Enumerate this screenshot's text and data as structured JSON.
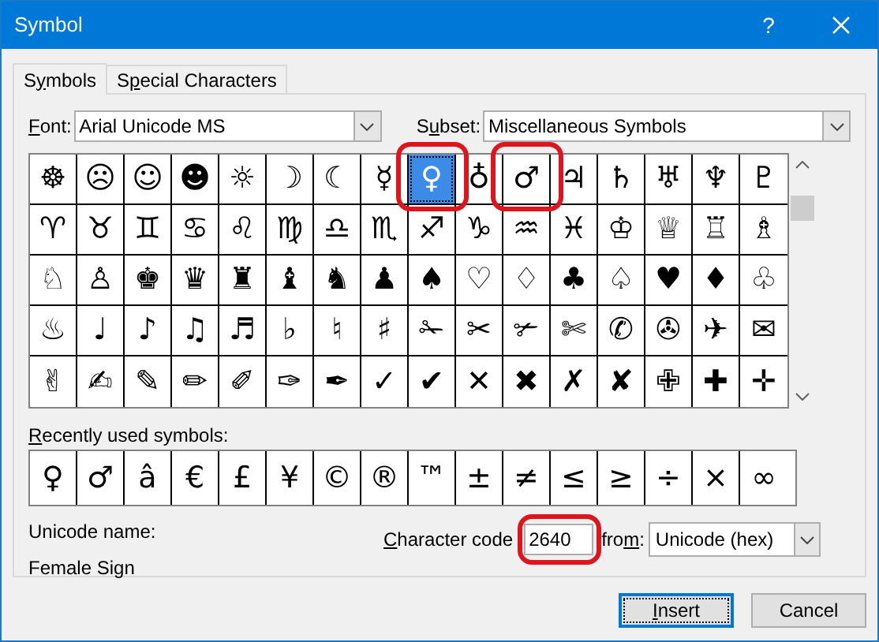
{
  "window": {
    "title": "Symbol",
    "help": "?"
  },
  "tabs": [
    {
      "label": {
        "before": "S",
        "access_key": "y",
        "after": "mbols"
      },
      "selected": true
    },
    {
      "label": {
        "before": "S",
        "access_key": "p",
        "after": "ecial Characters"
      },
      "selected": false
    }
  ],
  "font": {
    "label": {
      "access_key": "F",
      "after": "ont:"
    },
    "value": "Arial Unicode MS"
  },
  "subset": {
    "label": {
      "before": "S",
      "access_key": "u",
      "after": "bset:"
    },
    "value": "Miscellaneous Symbols"
  },
  "grid": {
    "rows": [
      [
        {
          "symbol": "☸",
          "selected": false,
          "highlighted": false
        },
        {
          "symbol": "☹",
          "selected": false,
          "highlighted": false
        },
        {
          "symbol": "☺",
          "selected": false,
          "highlighted": false
        },
        {
          "symbol": "☻",
          "selected": false,
          "highlighted": false
        },
        {
          "symbol": "☼",
          "selected": false,
          "highlighted": false
        },
        {
          "symbol": "☽",
          "selected": false,
          "highlighted": false
        },
        {
          "symbol": "☾",
          "selected": false,
          "highlighted": false
        },
        {
          "symbol": "☿",
          "selected": false,
          "highlighted": false
        },
        {
          "symbol": "♀",
          "selected": true,
          "highlighted": true
        },
        {
          "symbol": "♁",
          "selected": false,
          "highlighted": false
        },
        {
          "symbol": "♂",
          "selected": false,
          "highlighted": true
        },
        {
          "symbol": "♃",
          "selected": false,
          "highlighted": false
        },
        {
          "symbol": "♄",
          "selected": false,
          "highlighted": false
        },
        {
          "symbol": "♅",
          "selected": false,
          "highlighted": false
        },
        {
          "symbol": "♆",
          "selected": false,
          "highlighted": false
        },
        {
          "symbol": "♇",
          "selected": false,
          "highlighted": false
        }
      ],
      [
        {
          "symbol": "♈",
          "selected": false,
          "highlighted": false
        },
        {
          "symbol": "♉",
          "selected": false,
          "highlighted": false
        },
        {
          "symbol": "♊",
          "selected": false,
          "highlighted": false
        },
        {
          "symbol": "♋",
          "selected": false,
          "highlighted": false
        },
        {
          "symbol": "♌",
          "selected": false,
          "highlighted": false
        },
        {
          "symbol": "♍",
          "selected": false,
          "highlighted": false
        },
        {
          "symbol": "♎",
          "selected": false,
          "highlighted": false
        },
        {
          "symbol": "♏",
          "selected": false,
          "highlighted": false
        },
        {
          "symbol": "♐",
          "selected": false,
          "highlighted": false
        },
        {
          "symbol": "♑",
          "selected": false,
          "highlighted": false
        },
        {
          "symbol": "♒",
          "selected": false,
          "highlighted": false
        },
        {
          "symbol": "♓",
          "selected": false,
          "highlighted": false
        },
        {
          "symbol": "♔",
          "selected": false,
          "highlighted": false
        },
        {
          "symbol": "♕",
          "selected": false,
          "highlighted": false
        },
        {
          "symbol": "♖",
          "selected": false,
          "highlighted": false
        },
        {
          "symbol": "♗",
          "selected": false,
          "highlighted": false
        }
      ],
      [
        {
          "symbol": "♘",
          "selected": false,
          "highlighted": false
        },
        {
          "symbol": "♙",
          "selected": false,
          "highlighted": false
        },
        {
          "symbol": "♚",
          "selected": false,
          "highlighted": false
        },
        {
          "symbol": "♛",
          "selected": false,
          "highlighted": false
        },
        {
          "symbol": "♜",
          "selected": false,
          "highlighted": false
        },
        {
          "symbol": "♝",
          "selected": false,
          "highlighted": false
        },
        {
          "symbol": "♞",
          "selected": false,
          "highlighted": false
        },
        {
          "symbol": "♟",
          "selected": false,
          "highlighted": false
        },
        {
          "symbol": "♠",
          "selected": false,
          "highlighted": false
        },
        {
          "symbol": "♡",
          "selected": false,
          "highlighted": false
        },
        {
          "symbol": "♢",
          "selected": false,
          "highlighted": false
        },
        {
          "symbol": "♣",
          "selected": false,
          "highlighted": false
        },
        {
          "symbol": "♤",
          "selected": false,
          "highlighted": false
        },
        {
          "symbol": "♥",
          "selected": false,
          "highlighted": false
        },
        {
          "symbol": "♦",
          "selected": false,
          "highlighted": false
        },
        {
          "symbol": "♧",
          "selected": false,
          "highlighted": false
        }
      ],
      [
        {
          "symbol": "♨",
          "selected": false,
          "highlighted": false
        },
        {
          "symbol": "♩",
          "selected": false,
          "highlighted": false
        },
        {
          "symbol": "♪",
          "selected": false,
          "highlighted": false
        },
        {
          "symbol": "♫",
          "selected": false,
          "highlighted": false
        },
        {
          "symbol": "♬",
          "selected": false,
          "highlighted": false
        },
        {
          "symbol": "♭",
          "selected": false,
          "highlighted": false
        },
        {
          "symbol": "♮",
          "selected": false,
          "highlighted": false
        },
        {
          "symbol": "♯",
          "selected": false,
          "highlighted": false
        },
        {
          "symbol": "✁",
          "selected": false,
          "highlighted": false
        },
        {
          "symbol": "✂",
          "selected": false,
          "highlighted": false
        },
        {
          "symbol": "✃",
          "selected": false,
          "highlighted": false
        },
        {
          "symbol": "✄",
          "selected": false,
          "highlighted": false
        },
        {
          "symbol": "✆",
          "selected": false,
          "highlighted": false
        },
        {
          "symbol": "✇",
          "selected": false,
          "highlighted": false
        },
        {
          "symbol": "✈",
          "selected": false,
          "highlighted": false
        },
        {
          "symbol": "✉",
          "selected": false,
          "highlighted": false
        }
      ],
      [
        {
          "symbol": "✌",
          "selected": false,
          "highlighted": false
        },
        {
          "symbol": "✍",
          "selected": false,
          "highlighted": false
        },
        {
          "symbol": "✎",
          "selected": false,
          "highlighted": false
        },
        {
          "symbol": "✏",
          "selected": false,
          "highlighted": false
        },
        {
          "symbol": "✐",
          "selected": false,
          "highlighted": false
        },
        {
          "symbol": "✑",
          "selected": false,
          "highlighted": false
        },
        {
          "symbol": "✒",
          "selected": false,
          "highlighted": false
        },
        {
          "symbol": "✓",
          "selected": false,
          "highlighted": false
        },
        {
          "symbol": "✔",
          "selected": false,
          "highlighted": false
        },
        {
          "symbol": "✕",
          "selected": false,
          "highlighted": false
        },
        {
          "symbol": "✖",
          "selected": false,
          "highlighted": false
        },
        {
          "symbol": "✗",
          "selected": false,
          "highlighted": false
        },
        {
          "symbol": "✘",
          "selected": false,
          "highlighted": false
        },
        {
          "symbol": "✙",
          "selected": false,
          "highlighted": false
        },
        {
          "symbol": "✚",
          "selected": false,
          "highlighted": false
        },
        {
          "symbol": "✛",
          "selected": false,
          "highlighted": false
        }
      ]
    ]
  },
  "recent": {
    "label": {
      "access_key": "R",
      "after": "ecently used symbols:"
    },
    "symbols": [
      "♀",
      "♂",
      "â",
      "€",
      "£",
      "¥",
      "©",
      "®",
      "™",
      "±",
      "≠",
      "≤",
      "≥",
      "÷",
      "×",
      "∞"
    ]
  },
  "unicode_name": {
    "label": "Unicode name:",
    "value": "Female Sign"
  },
  "character_code": {
    "label": {
      "access_key": "C",
      "after": "haracter code"
    },
    "value": "2640",
    "highlighted": true
  },
  "from": {
    "label": {
      "before": "fro",
      "access_key": "m",
      "after": ":"
    },
    "value": "Unicode (hex)"
  },
  "buttons": [
    {
      "label": {
        "access_key": "I",
        "after": "nsert"
      },
      "default": true
    },
    {
      "label": {
        "after": "Cancel"
      },
      "default": false
    }
  ]
}
